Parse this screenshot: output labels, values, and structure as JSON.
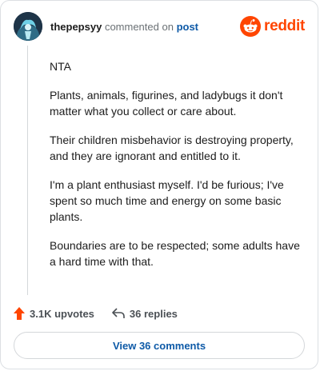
{
  "header": {
    "username": "thepepsyy",
    "commented_text": "commented on",
    "post_link": "post",
    "logo_text": "reddit"
  },
  "icons": {
    "avatar": "user-avatar",
    "logo": "reddit-snoo-icon",
    "upvote": "upvote-arrow-icon",
    "reply": "reply-arrow-icon"
  },
  "colors": {
    "brand": "#ff4500",
    "link": "#0e5aa7"
  },
  "comment": {
    "paragraphs": [
      "NTA",
      "Plants, animals, figurines, and ladybugs it don't matter what you collect or care about.",
      "Their children misbehavior is destroying property, and they are ignorant and entitled to it.",
      "I'm a plant enthusiast myself. I'd be furious; I've spent so much time and energy on some basic plants.",
      "Boundaries are to be respected; some adults have a hard time with that."
    ]
  },
  "actions": {
    "upvotes": "3.1K upvotes",
    "replies": "36 replies"
  },
  "footer": {
    "view_comments": "View 36 comments"
  }
}
